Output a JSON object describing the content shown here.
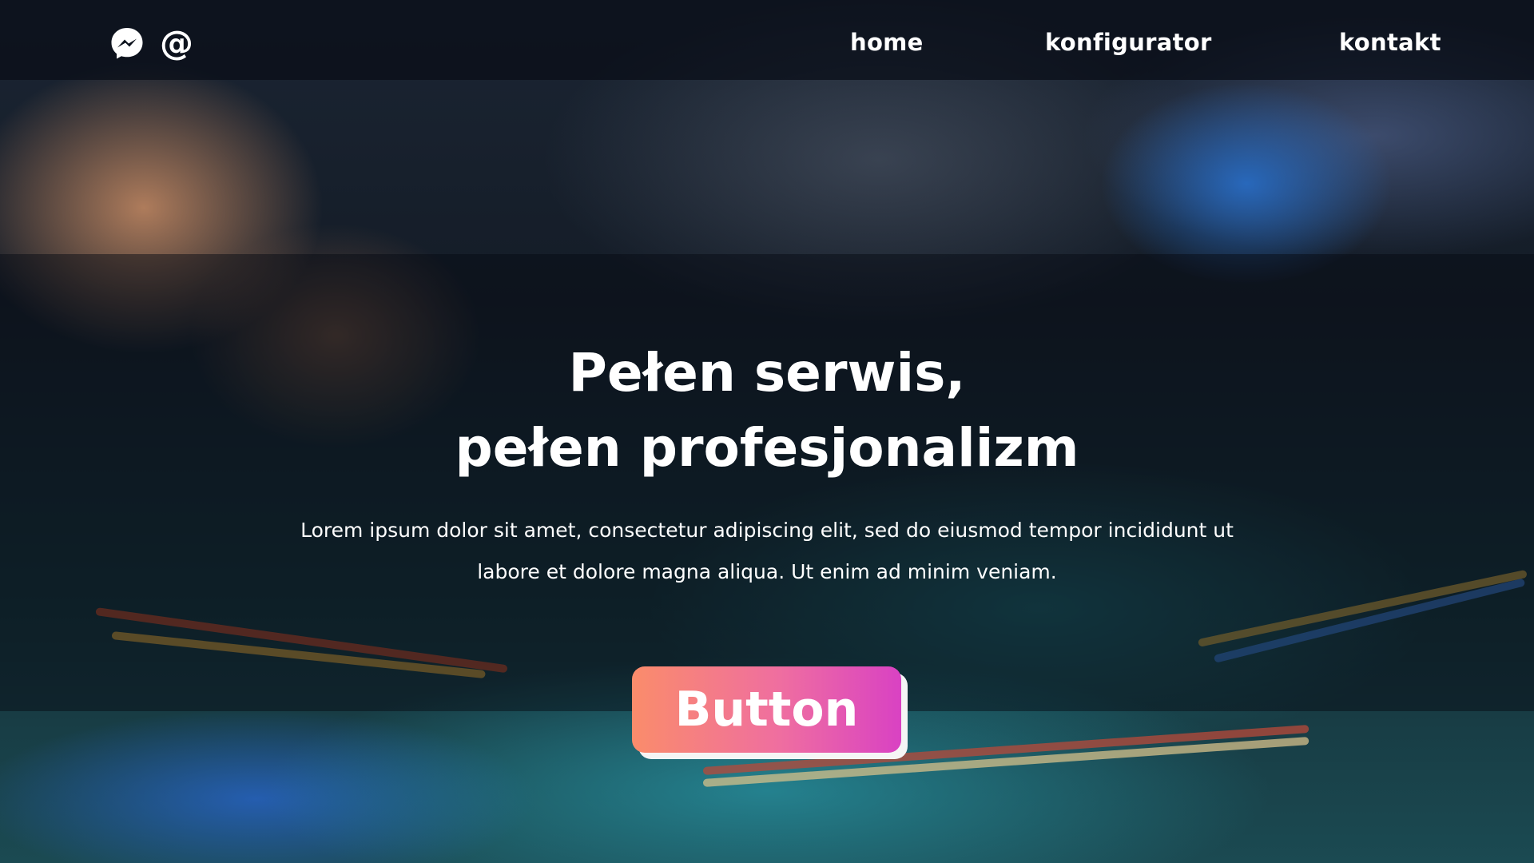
{
  "header": {
    "social": [
      {
        "icon": "messenger-icon"
      },
      {
        "icon": "at-sign-icon",
        "glyph": "@"
      }
    ],
    "nav": [
      {
        "label": "home"
      },
      {
        "label": "konfigurator"
      },
      {
        "label": "kontakt"
      }
    ]
  },
  "hero": {
    "title_line1": "Pełen serwis,",
    "title_line2": "pełen profesjonalizm",
    "description": "Lorem ipsum dolor sit amet, consectetur adipiscing elit, sed do eiusmod tempor incididunt ut labore et dolore magna aliqua. Ut enim ad minim veniam.",
    "cta_label": "Button"
  },
  "colors": {
    "cta_gradient_start": "#fa8c6b",
    "cta_gradient_end": "#d942c3",
    "text": "#ffffff"
  }
}
